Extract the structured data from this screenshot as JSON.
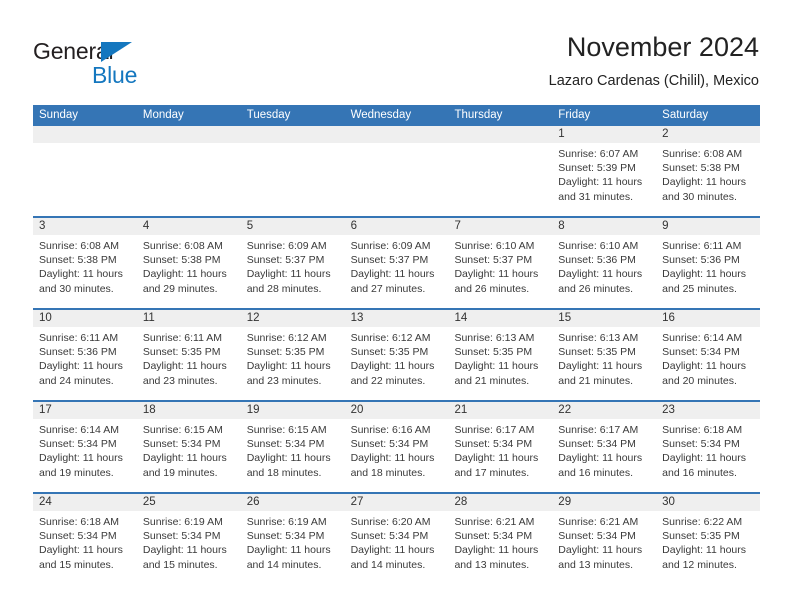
{
  "brand": {
    "name_part1": "General",
    "name_part2": "Blue",
    "flag_icon": "blue-triangle-flag-icon",
    "colors": {
      "text": "#231f20",
      "accent": "#1477bf"
    }
  },
  "header": {
    "title": "November 2024",
    "location": "Lazaro Cardenas (Chilil), Mexico"
  },
  "colors": {
    "header_blue": "#3575b5",
    "day_number_band": "#efefef",
    "cell_background": "#ffffff",
    "body_text": "#3a3a3a"
  },
  "calendar": {
    "weekdays": [
      "Sunday",
      "Monday",
      "Tuesday",
      "Wednesday",
      "Thursday",
      "Friday",
      "Saturday"
    ],
    "labels": {
      "sunrise": "Sunrise:",
      "sunset": "Sunset:",
      "daylight": "Daylight:"
    },
    "weeks": [
      [
        {
          "day": "",
          "empty": true
        },
        {
          "day": "",
          "empty": true
        },
        {
          "day": "",
          "empty": true
        },
        {
          "day": "",
          "empty": true
        },
        {
          "day": "",
          "empty": true
        },
        {
          "day": "1",
          "sunrise": "Sunrise: 6:07 AM",
          "sunset": "Sunset: 5:39 PM",
          "daylight": "Daylight: 11 hours and 31 minutes."
        },
        {
          "day": "2",
          "sunrise": "Sunrise: 6:08 AM",
          "sunset": "Sunset: 5:38 PM",
          "daylight": "Daylight: 11 hours and 30 minutes."
        }
      ],
      [
        {
          "day": "3",
          "sunrise": "Sunrise: 6:08 AM",
          "sunset": "Sunset: 5:38 PM",
          "daylight": "Daylight: 11 hours and 30 minutes."
        },
        {
          "day": "4",
          "sunrise": "Sunrise: 6:08 AM",
          "sunset": "Sunset: 5:38 PM",
          "daylight": "Daylight: 11 hours and 29 minutes."
        },
        {
          "day": "5",
          "sunrise": "Sunrise: 6:09 AM",
          "sunset": "Sunset: 5:37 PM",
          "daylight": "Daylight: 11 hours and 28 minutes."
        },
        {
          "day": "6",
          "sunrise": "Sunrise: 6:09 AM",
          "sunset": "Sunset: 5:37 PM",
          "daylight": "Daylight: 11 hours and 27 minutes."
        },
        {
          "day": "7",
          "sunrise": "Sunrise: 6:10 AM",
          "sunset": "Sunset: 5:37 PM",
          "daylight": "Daylight: 11 hours and 26 minutes."
        },
        {
          "day": "8",
          "sunrise": "Sunrise: 6:10 AM",
          "sunset": "Sunset: 5:36 PM",
          "daylight": "Daylight: 11 hours and 26 minutes."
        },
        {
          "day": "9",
          "sunrise": "Sunrise: 6:11 AM",
          "sunset": "Sunset: 5:36 PM",
          "daylight": "Daylight: 11 hours and 25 minutes."
        }
      ],
      [
        {
          "day": "10",
          "sunrise": "Sunrise: 6:11 AM",
          "sunset": "Sunset: 5:36 PM",
          "daylight": "Daylight: 11 hours and 24 minutes."
        },
        {
          "day": "11",
          "sunrise": "Sunrise: 6:11 AM",
          "sunset": "Sunset: 5:35 PM",
          "daylight": "Daylight: 11 hours and 23 minutes."
        },
        {
          "day": "12",
          "sunrise": "Sunrise: 6:12 AM",
          "sunset": "Sunset: 5:35 PM",
          "daylight": "Daylight: 11 hours and 23 minutes."
        },
        {
          "day": "13",
          "sunrise": "Sunrise: 6:12 AM",
          "sunset": "Sunset: 5:35 PM",
          "daylight": "Daylight: 11 hours and 22 minutes."
        },
        {
          "day": "14",
          "sunrise": "Sunrise: 6:13 AM",
          "sunset": "Sunset: 5:35 PM",
          "daylight": "Daylight: 11 hours and 21 minutes."
        },
        {
          "day": "15",
          "sunrise": "Sunrise: 6:13 AM",
          "sunset": "Sunset: 5:35 PM",
          "daylight": "Daylight: 11 hours and 21 minutes."
        },
        {
          "day": "16",
          "sunrise": "Sunrise: 6:14 AM",
          "sunset": "Sunset: 5:34 PM",
          "daylight": "Daylight: 11 hours and 20 minutes."
        }
      ],
      [
        {
          "day": "17",
          "sunrise": "Sunrise: 6:14 AM",
          "sunset": "Sunset: 5:34 PM",
          "daylight": "Daylight: 11 hours and 19 minutes."
        },
        {
          "day": "18",
          "sunrise": "Sunrise: 6:15 AM",
          "sunset": "Sunset: 5:34 PM",
          "daylight": "Daylight: 11 hours and 19 minutes."
        },
        {
          "day": "19",
          "sunrise": "Sunrise: 6:15 AM",
          "sunset": "Sunset: 5:34 PM",
          "daylight": "Daylight: 11 hours and 18 minutes."
        },
        {
          "day": "20",
          "sunrise": "Sunrise: 6:16 AM",
          "sunset": "Sunset: 5:34 PM",
          "daylight": "Daylight: 11 hours and 18 minutes."
        },
        {
          "day": "21",
          "sunrise": "Sunrise: 6:17 AM",
          "sunset": "Sunset: 5:34 PM",
          "daylight": "Daylight: 11 hours and 17 minutes."
        },
        {
          "day": "22",
          "sunrise": "Sunrise: 6:17 AM",
          "sunset": "Sunset: 5:34 PM",
          "daylight": "Daylight: 11 hours and 16 minutes."
        },
        {
          "day": "23",
          "sunrise": "Sunrise: 6:18 AM",
          "sunset": "Sunset: 5:34 PM",
          "daylight": "Daylight: 11 hours and 16 minutes."
        }
      ],
      [
        {
          "day": "24",
          "sunrise": "Sunrise: 6:18 AM",
          "sunset": "Sunset: 5:34 PM",
          "daylight": "Daylight: 11 hours and 15 minutes."
        },
        {
          "day": "25",
          "sunrise": "Sunrise: 6:19 AM",
          "sunset": "Sunset: 5:34 PM",
          "daylight": "Daylight: 11 hours and 15 minutes."
        },
        {
          "day": "26",
          "sunrise": "Sunrise: 6:19 AM",
          "sunset": "Sunset: 5:34 PM",
          "daylight": "Daylight: 11 hours and 14 minutes."
        },
        {
          "day": "27",
          "sunrise": "Sunrise: 6:20 AM",
          "sunset": "Sunset: 5:34 PM",
          "daylight": "Daylight: 11 hours and 14 minutes."
        },
        {
          "day": "28",
          "sunrise": "Sunrise: 6:21 AM",
          "sunset": "Sunset: 5:34 PM",
          "daylight": "Daylight: 11 hours and 13 minutes."
        },
        {
          "day": "29",
          "sunrise": "Sunrise: 6:21 AM",
          "sunset": "Sunset: 5:34 PM",
          "daylight": "Daylight: 11 hours and 13 minutes."
        },
        {
          "day": "30",
          "sunrise": "Sunrise: 6:22 AM",
          "sunset": "Sunset: 5:35 PM",
          "daylight": "Daylight: 11 hours and 12 minutes."
        }
      ]
    ]
  }
}
